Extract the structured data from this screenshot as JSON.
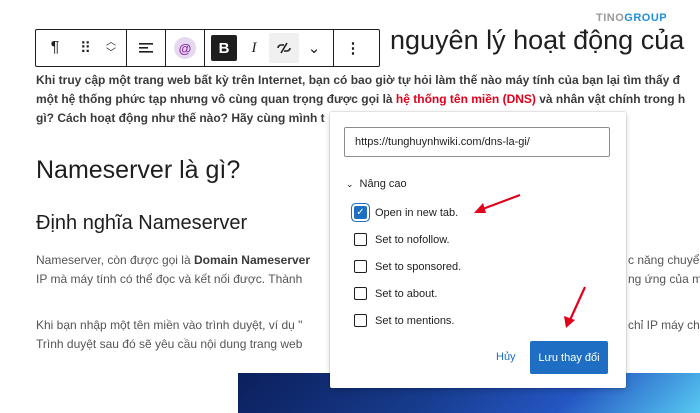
{
  "logo": {
    "part1": "TINO",
    "part2": "GROUP"
  },
  "content": {
    "title_fragment": "nguyên lý hoạt động của",
    "para1_lines": [
      "Khi truy cập một trang web bất kỳ trên Internet, bạn có bao giờ tự hỏi làm thế nào máy tính của bạn lại tìm thấy đ",
      "một hệ thống phức tạp nhưng vô cùng quan trọng được gọi là ",
      "gì? Cách hoạt động như thế nào? Hãy cùng mình t"
    ],
    "para1_link": "hệ thống tên miền (DNS)",
    "para1_line2_tail": " và nhân vật chính trong h",
    "heading_h2": "Nameserver là gì?",
    "heading_h3": "Định nghĩa Nameserver",
    "para2_line1_start": "Nameserver, còn được gọi là ",
    "para2_line1_bold": "Domain Nameserver",
    "para2_line1_right": "c năng chuyể",
    "para2_line2_left": "IP mà máy tính có thể đọc và kết nối được. Thành",
    "para2_line2_right": "ng ứng của m",
    "para3_line1_left": "Khi bạn nhập một tên miền vào trình duyệt, ví dụ \"",
    "para3_line1_right": "chỉ IP máy ch",
    "para3_line2_left": "Trình duyệt sau đó sẽ yêu cầu nội dung trang web"
  },
  "toolbar": {
    "paragraph_icon": "¶",
    "drag_icon": "⠿",
    "bold_label": "B",
    "italic_label": "I",
    "more_icon": "⋮",
    "chevron_icon": "⌄",
    "at_icon": "@"
  },
  "popover": {
    "url_value": "https://tunghuynhwiki.com/dns-la-gi/",
    "advanced_label": "Nâng cao",
    "options": [
      {
        "label": "Open in new tab.",
        "checked": true
      },
      {
        "label": "Set to nofollow.",
        "checked": false
      },
      {
        "label": "Set to sponsored.",
        "checked": false
      },
      {
        "label": "Set to about.",
        "checked": false
      },
      {
        "label": "Set to mentions.",
        "checked": false
      }
    ],
    "cancel_label": "Hủy",
    "save_label": "Lưu thay đổi"
  },
  "colors": {
    "accent": "#1e6fc4",
    "link_red": "#e0001b",
    "annotation_arrow": "#e0001b"
  }
}
